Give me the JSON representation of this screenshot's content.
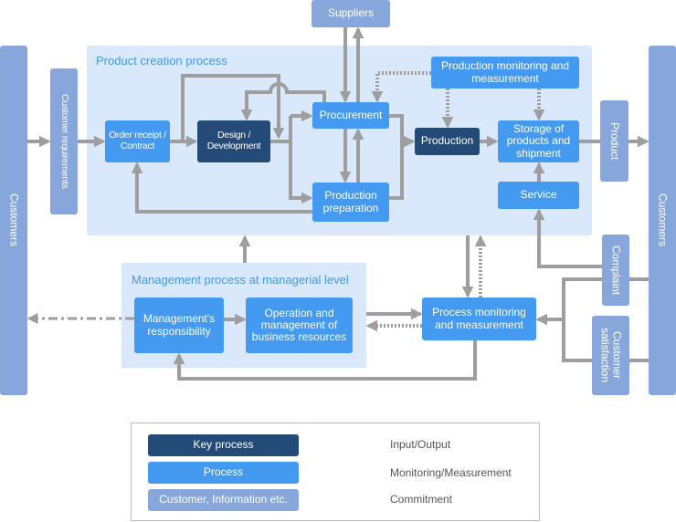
{
  "colors": {
    "key_process": "#244a78",
    "process": "#4499f0",
    "customer_info": "#87a6db",
    "panel": "#d9e8fa",
    "arrow": "#9e9e9e",
    "panel_title": "#4499ee"
  },
  "suppliers": "Suppliers",
  "customers_left": "Customers",
  "customers_right": "Customers",
  "customer_requirements": "Customer requirements",
  "product": "Product",
  "complaint": "Complaint",
  "customer_satisfaction": "Customer satisfaction",
  "product_creation": {
    "title": "Product creation process",
    "order_receipt": "Order receipt / Contract",
    "design": "Design / Development",
    "procurement": "Procurement",
    "production_preparation": "Production preparation",
    "production_monitoring": "Production monitoring and measurement",
    "production": "Production",
    "storage": "Storage of products and shipment",
    "service": "Service"
  },
  "management": {
    "title": "Management process at managerial level",
    "responsibility": "Management's responsibility",
    "operation": "Operation and management of business resources"
  },
  "process_monitoring": "Process monitoring and measurement",
  "legend": {
    "key_process": "Key process",
    "process": "Process",
    "customer_info": "Customer, Information etc.",
    "input_output": "Input/Output",
    "monitoring": "Monitoring/Measurement",
    "commitment": "Commitment"
  }
}
